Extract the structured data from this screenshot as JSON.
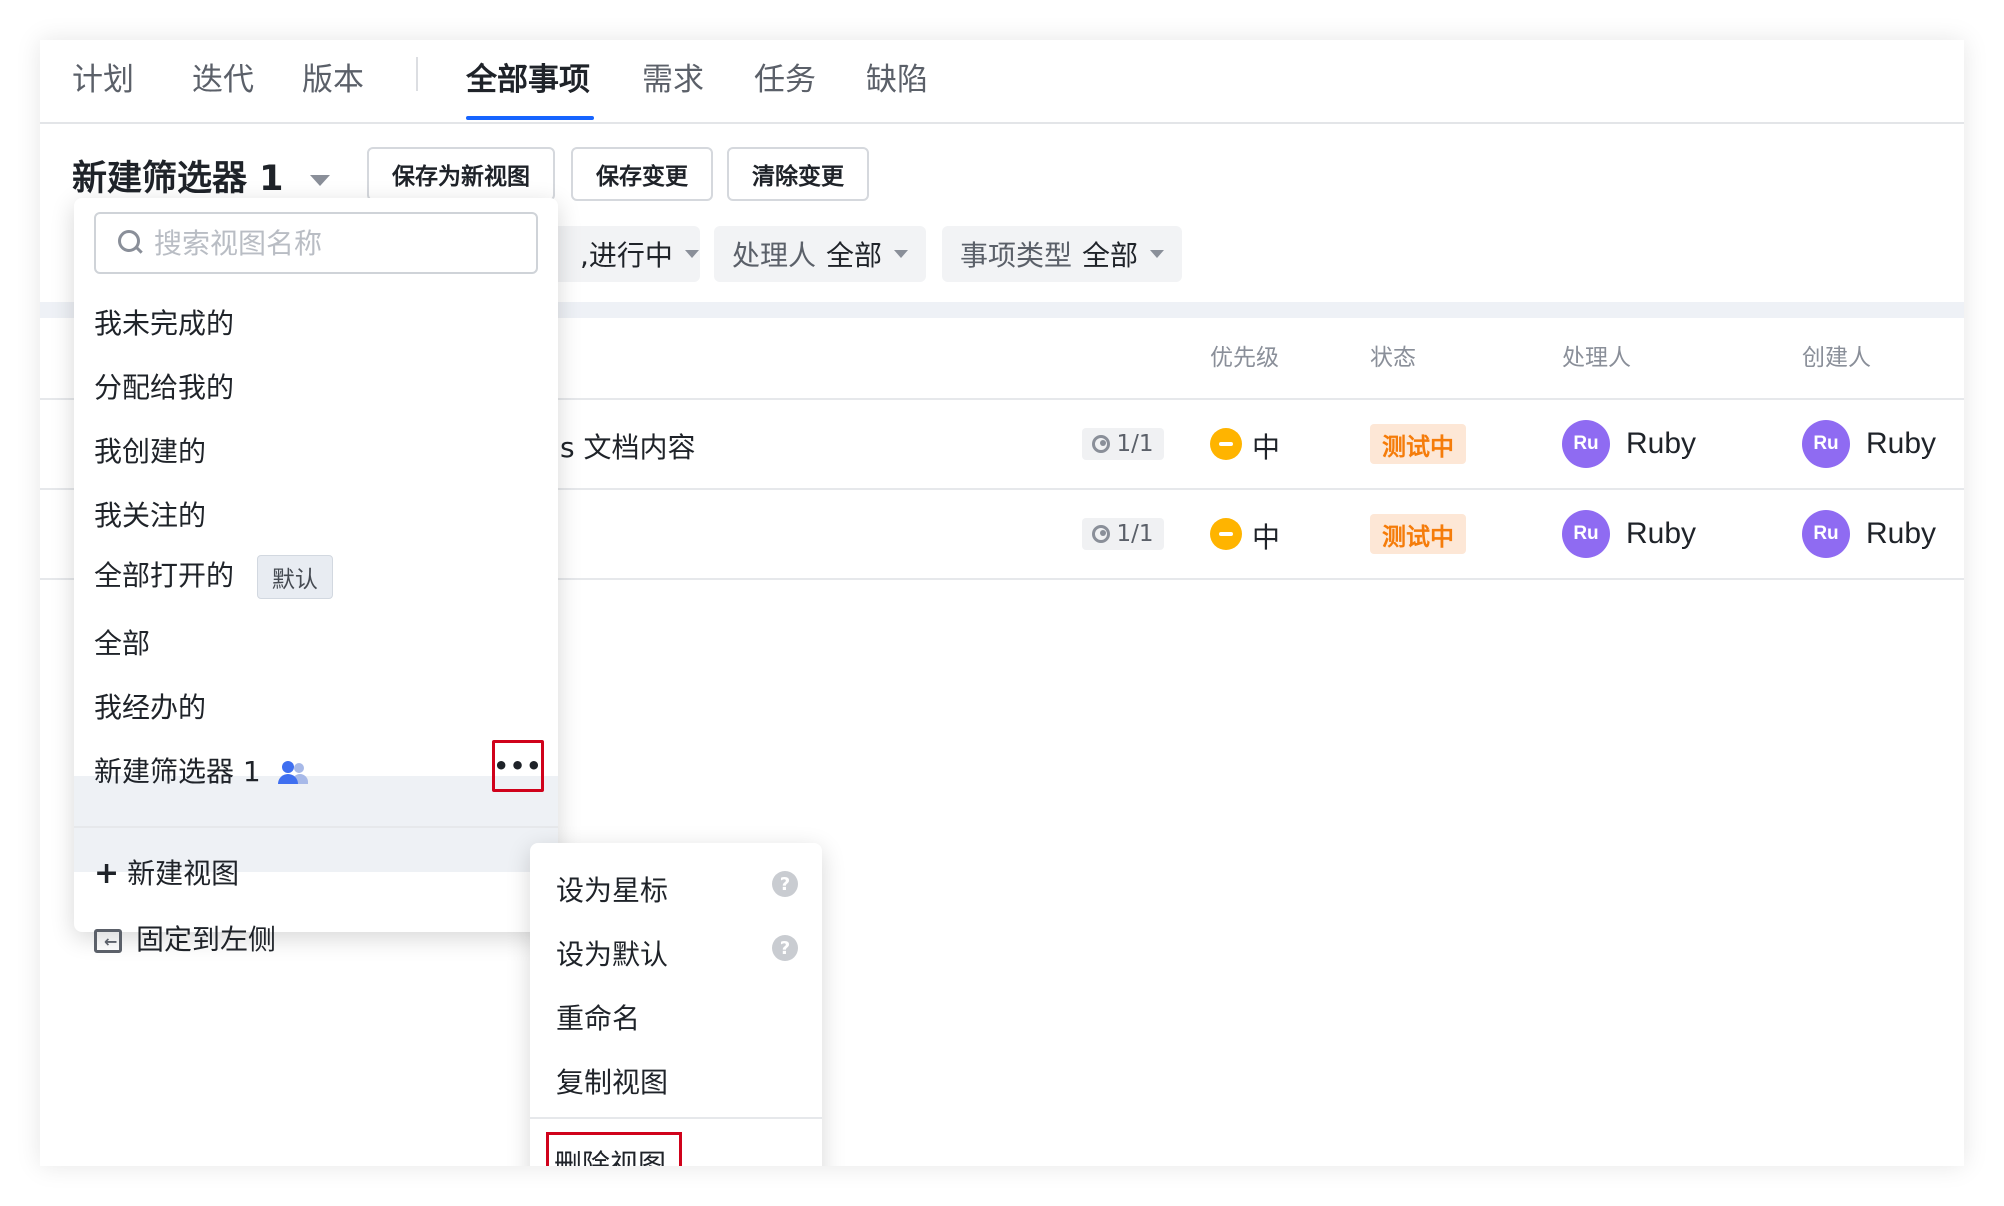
{
  "tabs": [
    {
      "label": "计划"
    },
    {
      "label": "迭代"
    },
    {
      "label": "版本"
    },
    {
      "label": "全部事项",
      "active": true
    },
    {
      "label": "需求"
    },
    {
      "label": "任务"
    },
    {
      "label": "缺陷"
    }
  ],
  "toolbar": {
    "view_title": "新建筛选器 1",
    "save_new_view": "保存为新视图",
    "save_changes": "保存变更",
    "clear_changes": "清除变更"
  },
  "filters": [
    {
      "value": ",进行中"
    },
    {
      "key": "处理人",
      "value": "全部"
    },
    {
      "key": "事项类型",
      "value": "全部"
    }
  ],
  "table": {
    "headers": {
      "priority": "优先级",
      "status": "状态",
      "assignee": "处理人",
      "creator": "创建人"
    },
    "rows": [
      {
        "title": "s 文档内容",
        "subtasks": "1/1",
        "priority": "中",
        "status": "测试中",
        "assignee_initials": "Ru",
        "assignee": "Ruby",
        "creator_initials": "Ru",
        "creator": "Ruby"
      },
      {
        "title": "",
        "subtasks": "1/1",
        "priority": "中",
        "status": "测试中",
        "assignee_initials": "Ru",
        "assignee": "Ruby",
        "creator_initials": "Ru",
        "creator": "Ruby"
      }
    ]
  },
  "view_dropdown": {
    "search_placeholder": "搜索视图名称",
    "items": [
      {
        "label": "我未完成的"
      },
      {
        "label": "分配给我的"
      },
      {
        "label": "我创建的"
      },
      {
        "label": "我关注的"
      },
      {
        "label": "全部打开的",
        "badge": "默认"
      },
      {
        "label": "全部"
      },
      {
        "label": "我经办的"
      },
      {
        "label": "新建筛选器 1",
        "shared": true,
        "selected": true
      }
    ],
    "more_label": "•••",
    "new_view": "新建视图",
    "pin_left": "固定到左侧"
  },
  "context_menu": {
    "items": [
      {
        "label": "设为星标",
        "help": "?"
      },
      {
        "label": "设为默认",
        "help": "?"
      },
      {
        "label": "重命名"
      },
      {
        "label": "复制视图"
      },
      {
        "label": "删除视图",
        "highlighted": true
      }
    ]
  },
  "colors": {
    "accent": "#1664ff",
    "priority_medium": "#ffb400",
    "status_testing_bg": "#fde7d6",
    "status_testing_text": "#f57c0a",
    "avatar": "#8f6bf2",
    "highlight_border": "#d0021b"
  }
}
